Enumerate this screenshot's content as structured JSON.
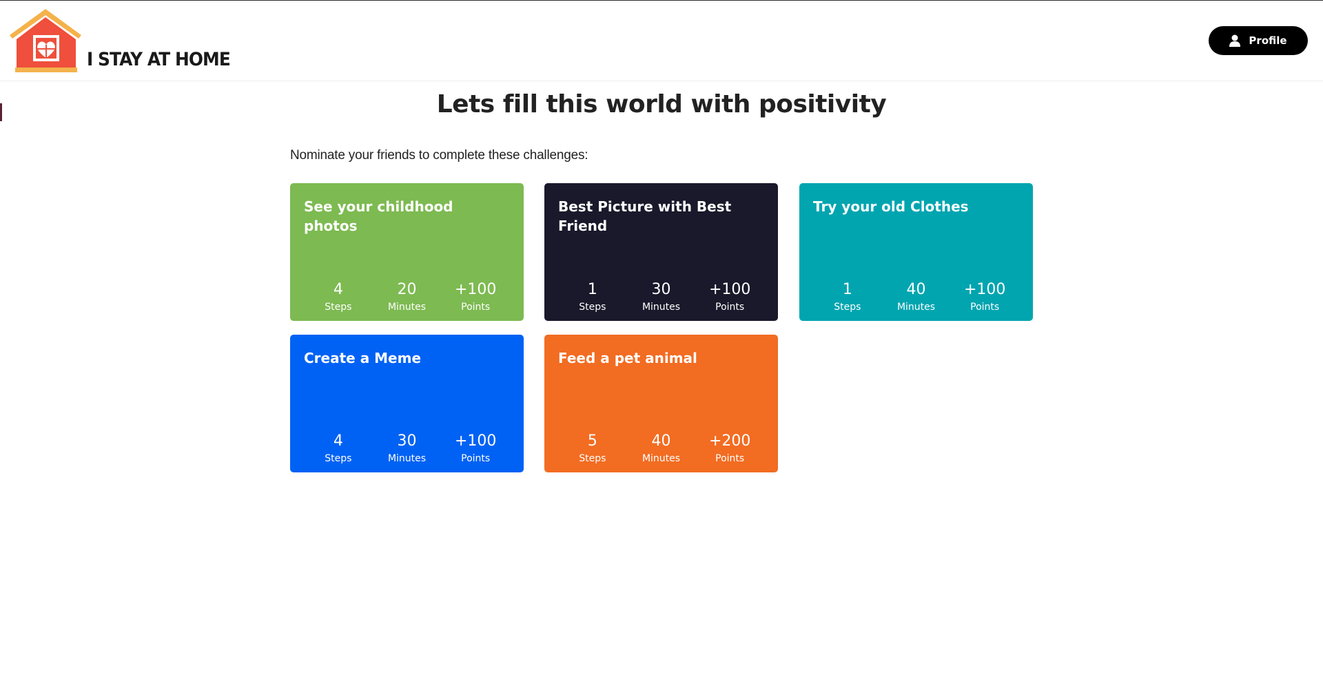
{
  "header": {
    "logo_text": "I STAY AT HOME",
    "profile_label": "Profile",
    "profile_icon": "user-icon"
  },
  "main": {
    "title": "Lets fill this world with positivity",
    "subtitle": "Nominate your friends to complete these challenges:"
  },
  "stat_labels": {
    "steps": "Steps",
    "minutes": "Minutes",
    "points": "Points"
  },
  "challenges": [
    {
      "title": "See your childhood photos",
      "steps": "4",
      "minutes": "20",
      "points": "+100",
      "color": "#7dba51"
    },
    {
      "title": "Best Picture with Best Friend",
      "steps": "1",
      "minutes": "30",
      "points": "+100",
      "color": "#1a192b"
    },
    {
      "title": "Try your old Clothes",
      "steps": "1",
      "minutes": "40",
      "points": "+100",
      "color": "#00a5b0"
    },
    {
      "title": "Create a Meme",
      "steps": "4",
      "minutes": "30",
      "points": "+100",
      "color": "#0062f5"
    },
    {
      "title": "Feed a pet animal",
      "steps": "5",
      "minutes": "40",
      "points": "+200",
      "color": "#f26c22"
    }
  ],
  "colors": {
    "logo_roof": "#f4b24b",
    "logo_house": "#ef4f3c",
    "profile_button": "#000000"
  }
}
